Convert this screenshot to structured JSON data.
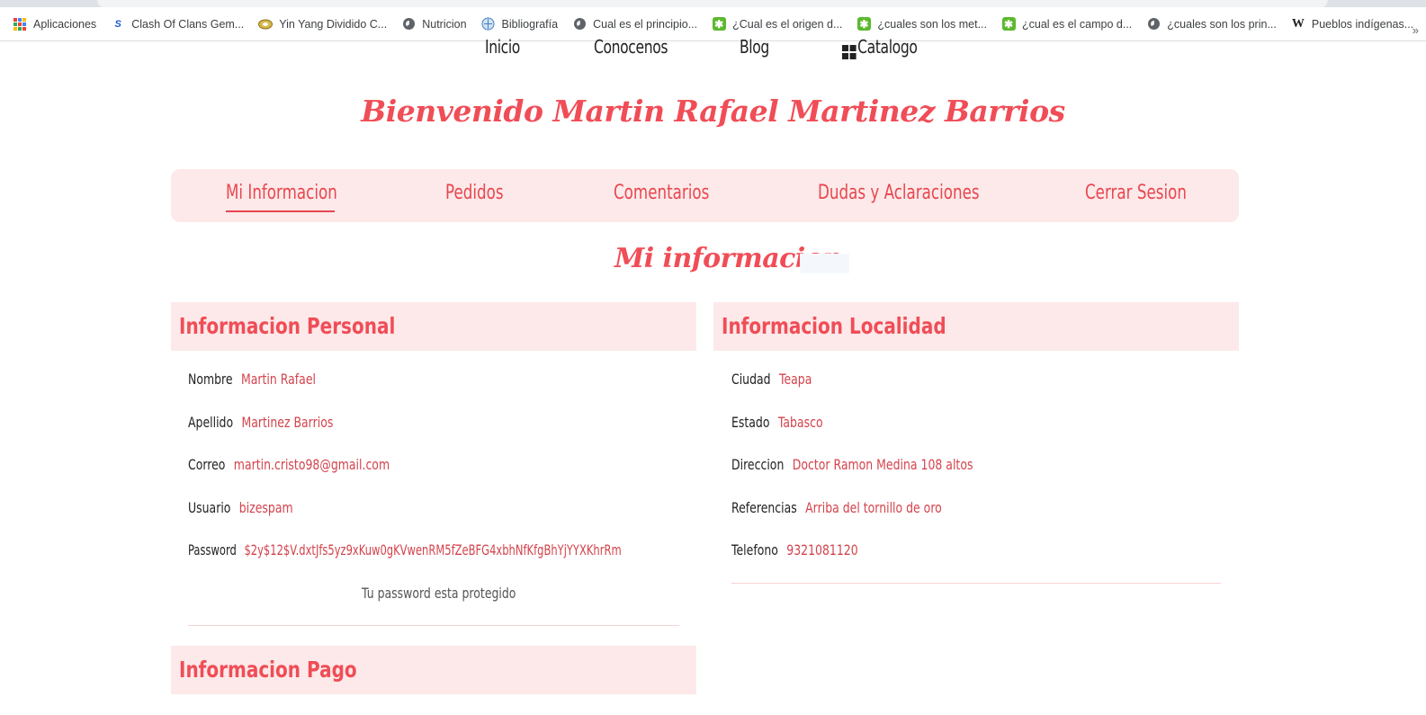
{
  "browser": {
    "bookmarks": [
      {
        "label": "Aplicaciones",
        "icon": "apps-grid-icon"
      },
      {
        "label": "Clash Of Clans Gem...",
        "icon": "s-logo-icon"
      },
      {
        "label": "Yin Yang Dividido C...",
        "icon": "yin-yang-icon"
      },
      {
        "label": "Nutricion",
        "icon": "globe-icon"
      },
      {
        "label": "Bibliografía",
        "icon": "globe-icon"
      },
      {
        "label": "Cual es el principio...",
        "icon": "globe-icon"
      },
      {
        "label": "¿Cual es el origen d...",
        "icon": "green-gear-icon"
      },
      {
        "label": "¿cuales son los met...",
        "icon": "green-gear-icon"
      },
      {
        "label": "¿cual es el campo d...",
        "icon": "green-gear-icon"
      },
      {
        "label": "¿cuales son los prin...",
        "icon": "globe-icon"
      },
      {
        "label": "Pueblos indígenas...",
        "icon": "wikipedia-icon"
      }
    ],
    "overflow": "»"
  },
  "nav": {
    "inicio": "Inicio",
    "conocenos": "Conocenos",
    "blog": "Blog",
    "catalogo": "Catalogo"
  },
  "welcome": "Bienvenido Martin Rafael Martinez Barrios",
  "tabs": {
    "mi_informacion": "Mi Informacion",
    "pedidos": "Pedidos",
    "comentarios": "Comentarios",
    "dudas": "Dudas y Aclaraciones",
    "cerrar": "Cerrar Sesion"
  },
  "section_title": "Mi informacion",
  "personal": {
    "title": "Informacion Personal",
    "nombre_label": "Nombre",
    "nombre": "Martin Rafael",
    "apellido_label": "Apellido",
    "apellido": "Martinez Barrios",
    "correo_label": "Correo",
    "correo": "martin.cristo98@gmail.com",
    "usuario_label": "Usuario",
    "usuario": "bizespam",
    "password_label": "Password",
    "password": "$2y$12$V.dxtJfs5yz9xKuw0gKVwenRM5fZeBFG4xbhNfKfgBhYjYYXKhrRm",
    "protected_note": "Tu password esta protegido"
  },
  "localidad": {
    "title": "Informacion Localidad",
    "ciudad_label": "Ciudad",
    "ciudad": "Teapa",
    "estado_label": "Estado",
    "estado": "Tabasco",
    "direccion_label": "Direccion",
    "direccion": "Doctor Ramon Medina 108 altos",
    "referencias_label": "Referencias",
    "referencias": "Arriba del tornillo de oro",
    "telefono_label": "Telefono",
    "telefono": "9321081120"
  },
  "pago": {
    "title": "Informacion Pago"
  },
  "colors": {
    "accent": "#f04d57",
    "panel": "#fde9e9"
  }
}
